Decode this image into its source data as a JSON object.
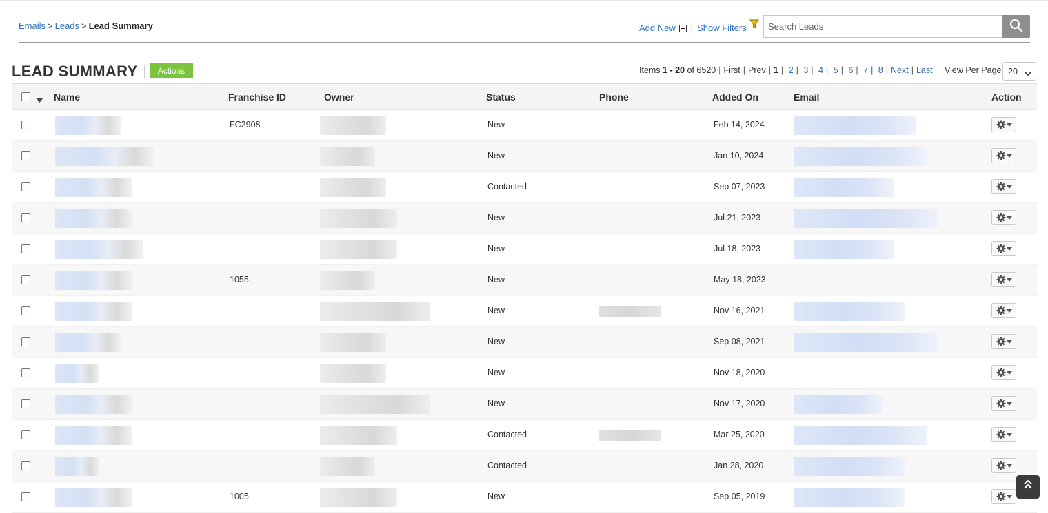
{
  "breadcrumb": {
    "emails": "Emails",
    "leads": "Leads",
    "current": "Lead Summary",
    "sep": ">"
  },
  "toolbar": {
    "add_new": "Add New",
    "show_filters": "Show Filters",
    "divider": "|"
  },
  "search": {
    "placeholder": "Search Leads",
    "value": ""
  },
  "page": {
    "title": "LEAD SUMMARY",
    "actions_label": "Actions"
  },
  "pager": {
    "items_label": "Items",
    "range": "1 - 20",
    "of_label": "of",
    "total": "6520",
    "first": "First",
    "prev": "Prev",
    "current": "1",
    "pages": [
      "2",
      "3",
      "4",
      "5",
      "6",
      "7",
      "8"
    ],
    "next": "Next",
    "last": "Last"
  },
  "per_page": {
    "label": "View Per Page",
    "value": "20"
  },
  "table": {
    "columns": {
      "name": "Name",
      "franchise_id": "Franchise ID",
      "owner": "Owner",
      "status": "Status",
      "phone": "Phone",
      "added_on": "Added On",
      "email": "Email",
      "action": "Action"
    },
    "rows": [
      {
        "franchise_id": "FC2908",
        "status": "New",
        "added_on": "Feb 14, 2024"
      },
      {
        "franchise_id": "",
        "status": "New",
        "added_on": "Jan 10, 2024"
      },
      {
        "franchise_id": "",
        "status": "Contacted",
        "added_on": "Sep 07, 2023"
      },
      {
        "franchise_id": "",
        "status": "New",
        "added_on": "Jul 21, 2023"
      },
      {
        "franchise_id": "",
        "status": "New",
        "added_on": "Jul 18, 2023"
      },
      {
        "franchise_id": "1055",
        "status": "New",
        "added_on": "May 18, 2023"
      },
      {
        "franchise_id": "",
        "status": "New",
        "added_on": "Nov 16, 2021"
      },
      {
        "franchise_id": "",
        "status": "New",
        "added_on": "Sep 08, 2021"
      },
      {
        "franchise_id": "",
        "status": "New",
        "added_on": "Nov 18, 2020"
      },
      {
        "franchise_id": "",
        "status": "New",
        "added_on": "Nov 17, 2020"
      },
      {
        "franchise_id": "",
        "status": "Contacted",
        "added_on": "Mar 25, 2020"
      },
      {
        "franchise_id": "",
        "status": "Contacted",
        "added_on": "Jan 28, 2020"
      },
      {
        "franchise_id": "1005",
        "status": "New",
        "added_on": "Sep 05, 2019"
      }
    ]
  },
  "icons": {
    "filter": "funnel-icon",
    "search": "search-icon",
    "row_action": "gear-icon",
    "scroll_top": "double-chevron-up-icon",
    "add": "plus-box-icon"
  },
  "colors": {
    "link": "#2a6ebb",
    "actions_button": "#7cc33e",
    "search_button": "#8e8e8e",
    "filter_icon": "#e6b800"
  }
}
